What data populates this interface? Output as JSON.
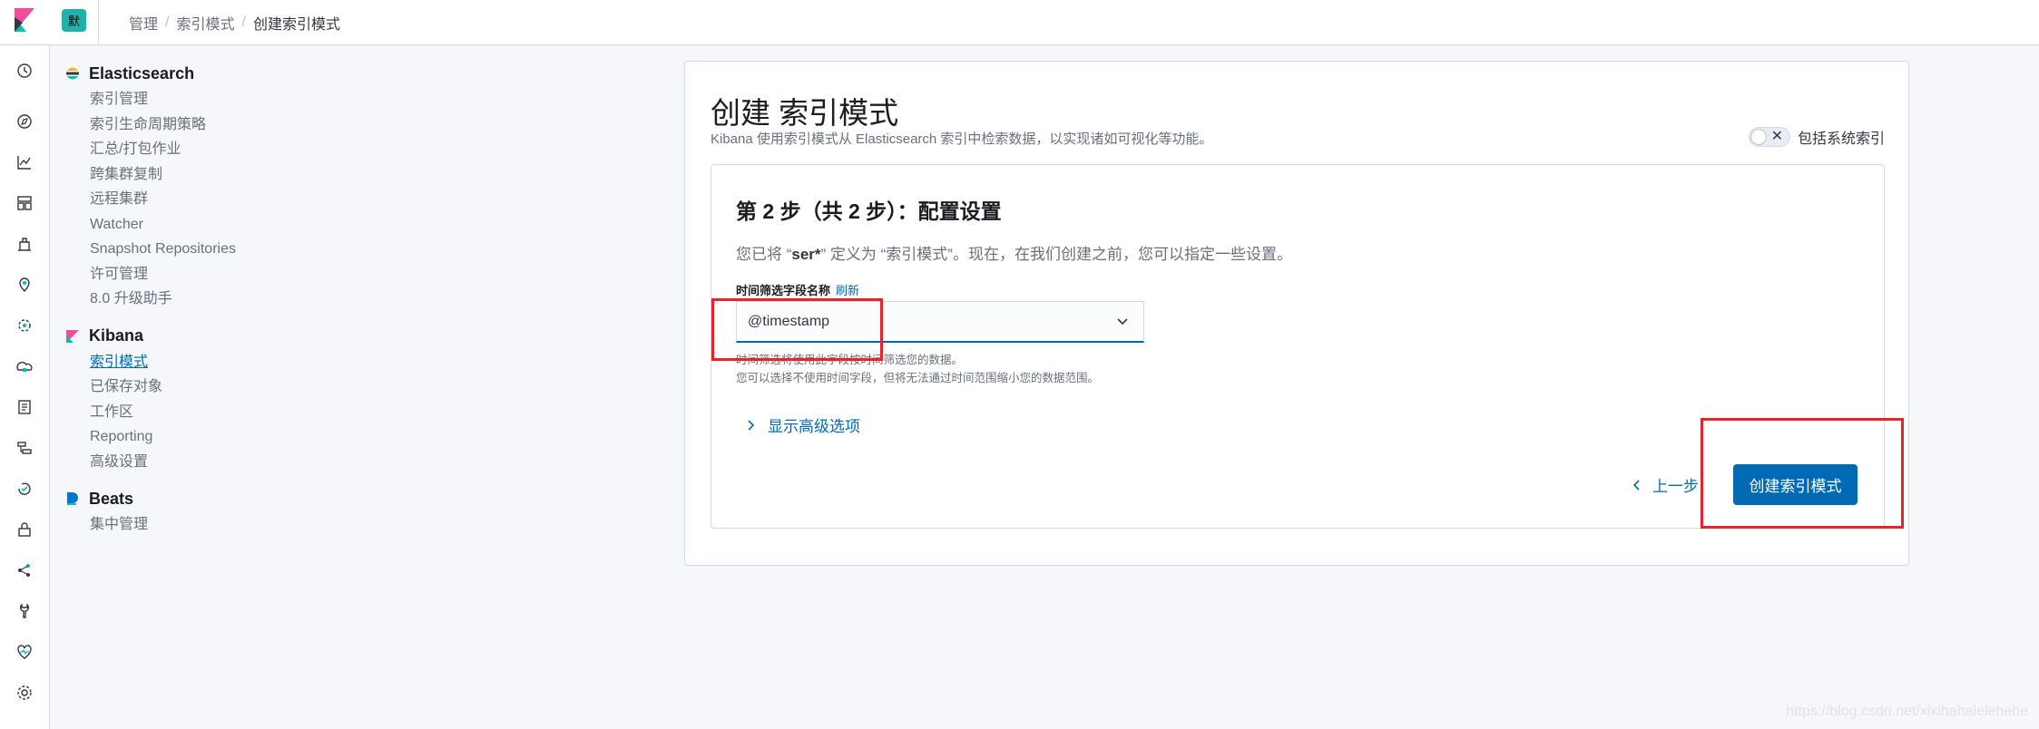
{
  "topbar": {
    "space_initial": "默",
    "breadcrumbs": [
      "管理",
      "索引模式",
      "创建索引模式"
    ]
  },
  "rail_icons": [
    "clock-icon",
    "compass-icon",
    "visualize-icon",
    "dashboard-icon",
    "canvas-icon",
    "maps-icon",
    "ml-icon",
    "infrastructure-icon",
    "logs-icon",
    "apm-icon",
    "uptime-icon",
    "siem-icon",
    "graph-icon",
    "dev-tools-icon",
    "monitoring-icon",
    "management-gear-icon"
  ],
  "sidenav": {
    "elasticsearch": {
      "title": "Elasticsearch",
      "items": [
        "索引管理",
        "索引生命周期策略",
        "汇总/打包作业",
        "跨集群复制",
        "远程集群",
        "Watcher",
        "Snapshot Repositories",
        "许可管理",
        "8.0 升级助手"
      ]
    },
    "kibana": {
      "title": "Kibana",
      "items": [
        "索引模式",
        "已保存对象",
        "工作区",
        "Reporting",
        "高级设置"
      ],
      "active_index": 0
    },
    "beats": {
      "title": "Beats",
      "items": [
        "集中管理"
      ]
    }
  },
  "page": {
    "title": "创建 索引模式",
    "subtitle": "Kibana 使用索引模式从 Elasticsearch 索引中检索数据，以实现诸如可视化等功能。",
    "toggle_label": "包括系统索引",
    "toggle_on": false
  },
  "step": {
    "title": "第 2 步（共 2 步）：配置设置",
    "desc_prefix": "您已将 “",
    "desc_pattern": "ser*",
    "desc_suffix": "” 定义为 “索引模式”。现在，在我们创建之前，您可以指定一些设置。",
    "field_label": "时间筛选字段名称",
    "refresh_label": "刷新",
    "select_value": "@timestamp",
    "help_line1": "时间筛选将使用此字段按时间筛选您的数据。",
    "help_line2": "您可以选择不使用时间字段，但将无法通过时间范围缩小您的数据范围。",
    "advanced_label": "显示高级选项",
    "back_label": "上一步",
    "create_label": "创建索引模式"
  },
  "colors": {
    "primary": "#006bb4",
    "annotation_red": "#e8242a",
    "badge": "#20b2aa"
  },
  "watermark": "https://blog.csdn.net/xixihahalelehehe"
}
